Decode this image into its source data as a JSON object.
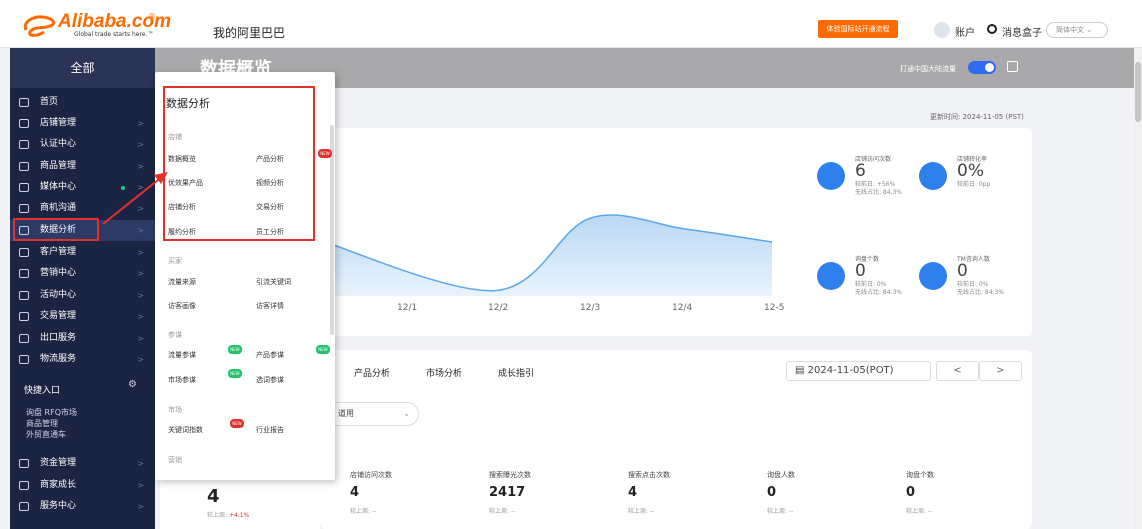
{
  "topbar": {
    "logo_text": "Alibaba.com",
    "logo_reg": "®",
    "logo_slogan": "Global trade starts here.™",
    "my_alibaba": "我的阿里巴巴",
    "promo_button": "体验国际站开通流程",
    "account": "账户",
    "messages": "消息盒子",
    "language": "简体中文 ⌄"
  },
  "sidebar": {
    "all_label": "全部",
    "items": [
      {
        "label": "首页"
      },
      {
        "label": "店铺管理"
      },
      {
        "label": "认证中心"
      },
      {
        "label": "商品管理"
      },
      {
        "label": "媒体中心"
      },
      {
        "label": "商机沟通"
      },
      {
        "label": "数据分析"
      },
      {
        "label": "客户管理"
      },
      {
        "label": "营销中心"
      },
      {
        "label": "活动中心"
      },
      {
        "label": "交易管理"
      },
      {
        "label": "出口服务"
      },
      {
        "label": "物流服务"
      }
    ],
    "quick_title": "快捷入口",
    "quick_links": [
      "询盘 RFQ市场",
      "商品管理",
      "外贸直通车"
    ],
    "bottom_items": [
      {
        "label": "资金管理"
      },
      {
        "label": "商家成长"
      },
      {
        "label": "服务中心"
      }
    ],
    "arrow": ">"
  },
  "header": {
    "page_title": "数据概览",
    "toggle_label": "打通中国大陆流量",
    "update_time": "更新时间: 2024-11-05 (PST)"
  },
  "popup": {
    "title": "数据分析",
    "sections": [
      {
        "title": "店铺",
        "items": [
          "数据概览",
          "产品分析",
          "优效果产品",
          "视频分析",
          "店铺分析",
          "交易分析",
          "履约分析",
          "员工分析"
        ]
      },
      {
        "title": "买家",
        "items": [
          "流量来源",
          "引流关键词",
          "访客画像",
          "访客详情"
        ]
      },
      {
        "title": "参谋",
        "items": [
          "流量参谋",
          "产品参谋",
          "市场参谋",
          "选词参谋"
        ]
      },
      {
        "title": "市场",
        "items": [
          "关键词指数",
          "行业报告"
        ]
      },
      {
        "title": "营销",
        "items": []
      }
    ],
    "badges": {
      "new_red": "NEW",
      "new_green": "NEW"
    }
  },
  "chart_data": {
    "type": "area",
    "x": [
      "12/1",
      "12/2",
      "12/3",
      "12/4",
      "12-5"
    ],
    "visible_axis_fragment": "%",
    "series": [
      {
        "values": [
          0.55,
          0.05,
          0.72,
          0.62,
          0.5
        ]
      }
    ],
    "grid": false,
    "color": "#cfe4f8"
  },
  "kpis": [
    {
      "label": "店铺访问次数",
      "value": "6",
      "sub1": "较前日: +56%",
      "sub2": "无线占比: 84.3%",
      "icon": "store-icon",
      "color": "#2f80ed"
    },
    {
      "label": "店铺转化率",
      "value": "0%",
      "sub1": "较前日: 0pp",
      "sub2": "",
      "icon": "funnel-icon",
      "color": "#2f80ed"
    },
    {
      "label": "询盘个数",
      "value": "0",
      "sub1": "较前日: 0%",
      "sub2": "无线占比: 84.3%",
      "icon": "mail-icon",
      "color": "#2f80ed"
    },
    {
      "label": "TM咨询人数",
      "value": "0",
      "sub1": "较前日: 0%",
      "sub2": "无线占比: 84.3%",
      "icon": "chat-icon",
      "color": "#2f80ed"
    }
  ],
  "tabs": [
    "产品分析",
    "市场分析",
    "成长指引"
  ],
  "date_filter": "2024-11-05(POT)",
  "prev_label": "<",
  "next_label": ">",
  "select_text": "道用",
  "metrics_left": {
    "value": "4",
    "sub": "较上周:",
    "delta": "+4.1%"
  },
  "metrics": [
    {
      "label": "店铺访问次数",
      "value": "4",
      "sub": "较上周: --"
    },
    {
      "label": "搜索曝光次数",
      "value": "2417",
      "sub": "较上周: --"
    },
    {
      "label": "搜索点击次数",
      "value": "4",
      "sub": "较上周: --"
    },
    {
      "label": "询盘人数",
      "value": "0",
      "sub": "较上周: --"
    },
    {
      "label": "询盘个数",
      "value": "0",
      "sub": "较上周: --"
    }
  ]
}
